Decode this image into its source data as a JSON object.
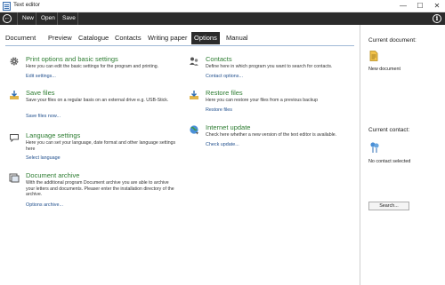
{
  "window": {
    "title": "Text editor",
    "controls": {
      "minimize": "—",
      "maximize": "☐",
      "close": "✕"
    }
  },
  "toolbar": {
    "back_glyph": "←",
    "new_label": "New",
    "open_label": "Open",
    "save_label": "Save",
    "info_glyph": "i"
  },
  "tabs": [
    {
      "label": "Document"
    },
    {
      "label": "Preview"
    },
    {
      "label": "Catalogue"
    },
    {
      "label": "Contacts"
    },
    {
      "label": "Writing paper"
    },
    {
      "label": "Options",
      "active": true
    },
    {
      "label": "Manual"
    }
  ],
  "options": {
    "print": {
      "icon": "gear-icon",
      "title": "Print options and basic settings",
      "desc": "Here you can edit the basic settings for the program and printing.",
      "link": "Edit settings..."
    },
    "save": {
      "icon": "save-download-icon",
      "title": "Save files",
      "desc": "Save your files on a regular basis on an external drive e.g. USB-Stick.",
      "link": "Save files now..."
    },
    "language": {
      "icon": "speech-bubble-icon",
      "title": "Language settings",
      "desc": "Here you can set your language, date format and other language settings here",
      "link": "Select language"
    },
    "archive": {
      "icon": "archive-icon",
      "title": "Document archive",
      "desc": "With the additional program Document archive you are able to archive your letters and documents. Pleaser enter the installation directory of the archive.",
      "link": "Options archive..."
    },
    "contacts": {
      "icon": "contacts-people-icon",
      "title": "Contacts",
      "desc": "Define here in which program you want to search for contacts.",
      "link": "Contact options..."
    },
    "restore": {
      "icon": "restore-upload-icon",
      "title": "Restore files",
      "desc": "Here you can restore your files from a previous backup",
      "link": "Restore files"
    },
    "update": {
      "icon": "globe-update-icon",
      "title": "Internet update",
      "desc": "Check here whether a new version of the text editor is available.",
      "link": "Check update..."
    }
  },
  "sidebar": {
    "current_document_label": "Current document:",
    "current_document_value": "New document",
    "current_contact_label": "Current contact:",
    "current_contact_value": "No contact selected",
    "search_button": "Search..."
  },
  "colors": {
    "toolbar_bg": "#2b2b2b",
    "title_green": "#2e7d32",
    "link_blue": "#1f4e8c"
  }
}
